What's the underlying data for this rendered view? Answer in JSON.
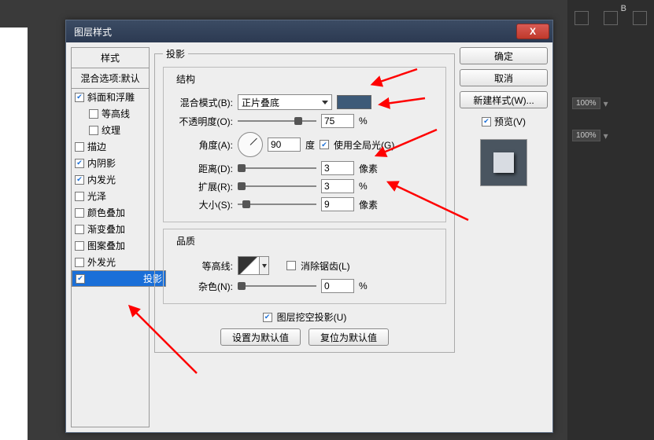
{
  "window": {
    "title": "图层样式"
  },
  "sidebar": {
    "header": "样式",
    "blend_defaults": "混合选项:默认",
    "items": [
      {
        "label": "斜面和浮雕",
        "checked": true,
        "indent": false
      },
      {
        "label": "等高线",
        "checked": false,
        "indent": true
      },
      {
        "label": "纹理",
        "checked": false,
        "indent": true
      },
      {
        "label": "描边",
        "checked": false,
        "indent": false
      },
      {
        "label": "内阴影",
        "checked": true,
        "indent": false
      },
      {
        "label": "内发光",
        "checked": true,
        "indent": false
      },
      {
        "label": "光泽",
        "checked": false,
        "indent": false
      },
      {
        "label": "颜色叠加",
        "checked": false,
        "indent": false
      },
      {
        "label": "渐变叠加",
        "checked": false,
        "indent": false
      },
      {
        "label": "图案叠加",
        "checked": false,
        "indent": false
      },
      {
        "label": "外发光",
        "checked": false,
        "indent": false
      },
      {
        "label": "投影",
        "checked": true,
        "indent": false,
        "selected": true
      }
    ]
  },
  "panel": {
    "title": "投影",
    "structure": {
      "legend": "结构",
      "blend_mode_label": "混合模式(B):",
      "blend_mode_value": "正片叠底",
      "opacity_label": "不透明度(O):",
      "opacity_value": "75",
      "opacity_unit": "%",
      "angle_label": "角度(A):",
      "angle_value": "90",
      "angle_unit": "度",
      "global_light_label": "使用全局光(G)",
      "global_light_checked": true,
      "distance_label": "距离(D):",
      "distance_value": "3",
      "distance_unit": "像素",
      "spread_label": "扩展(R):",
      "spread_value": "3",
      "spread_unit": "%",
      "size_label": "大小(S):",
      "size_value": "9",
      "size_unit": "像素"
    },
    "quality": {
      "legend": "品质",
      "contour_label": "等高线:",
      "antialias_label": "消除锯齿(L)",
      "antialias_checked": false,
      "noise_label": "杂色(N):",
      "noise_value": "0",
      "noise_unit": "%"
    },
    "knockout_label": "图层挖空投影(U)",
    "knockout_checked": true,
    "set_default_btn": "设置为默认值",
    "reset_default_btn": "复位为默认值"
  },
  "right": {
    "ok": "确定",
    "cancel": "取消",
    "new_style": "新建样式(W)...",
    "preview_label": "预览(V)",
    "preview_checked": true
  },
  "bg_right": {
    "b_label": "B",
    "pct": "100%"
  }
}
